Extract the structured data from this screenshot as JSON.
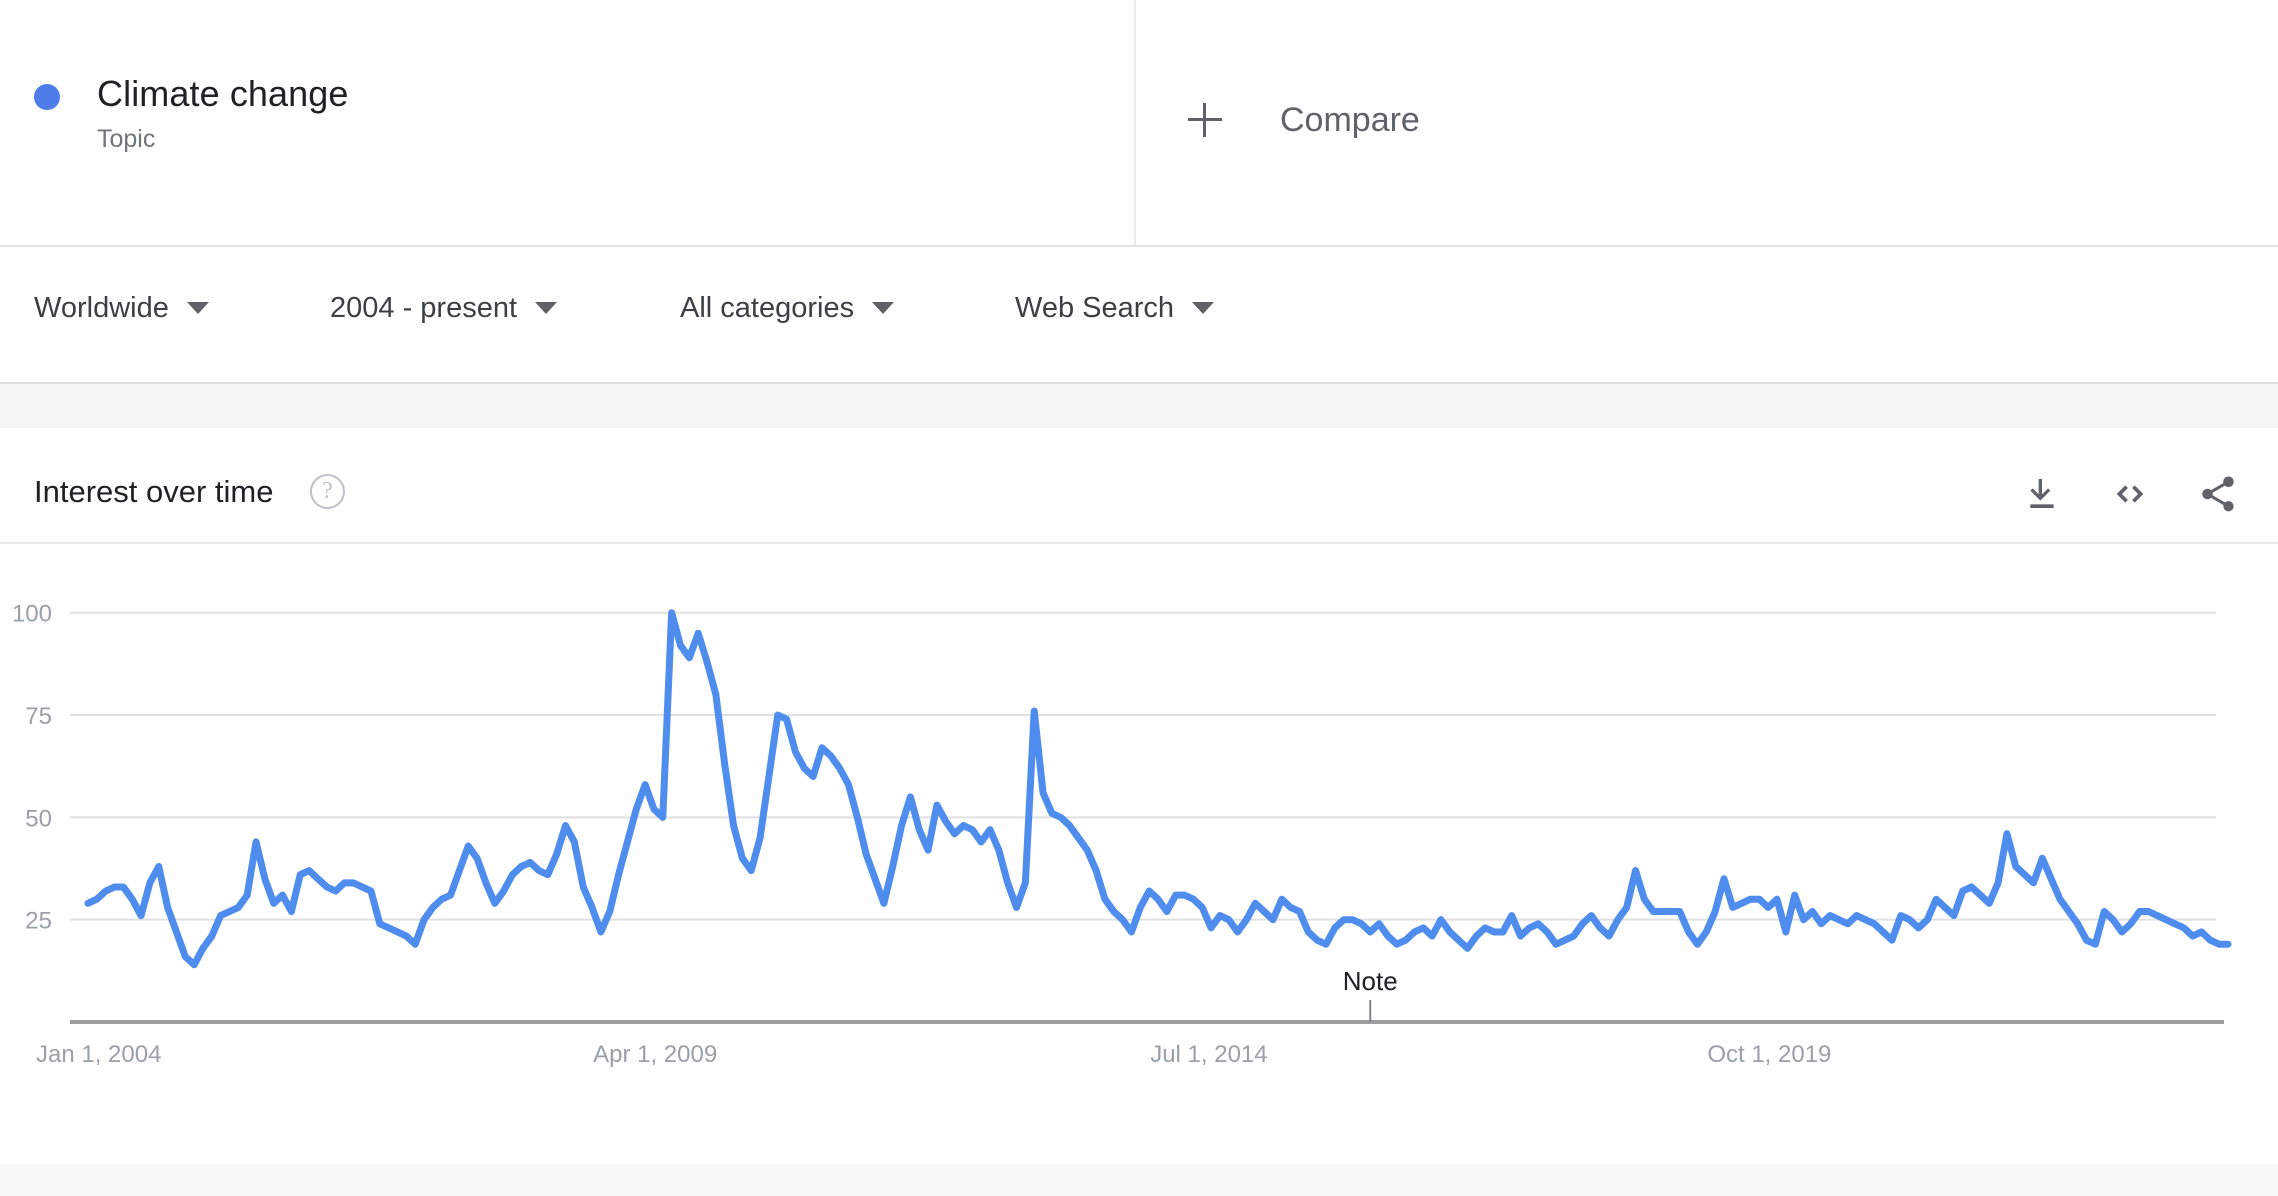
{
  "terms": {
    "items": [
      {
        "name": "Climate change",
        "type": "Topic",
        "color": "#4e7ce8"
      }
    ],
    "compare_label": "Compare"
  },
  "filters": [
    {
      "id": "location",
      "label": "Worldwide"
    },
    {
      "id": "time",
      "label": "2004 - present"
    },
    {
      "id": "category",
      "label": "All categories"
    },
    {
      "id": "search_type",
      "label": "Web Search"
    }
  ],
  "card": {
    "title": "Interest over time",
    "help_glyph": "?",
    "actions": [
      {
        "name": "download-icon",
        "label": "Download"
      },
      {
        "name": "embed-icon",
        "label": "Embed"
      },
      {
        "name": "share-icon",
        "label": "Share"
      }
    ]
  },
  "chart_data": {
    "type": "line",
    "title": "Interest over time",
    "xlabel": "",
    "ylabel": "",
    "ylim": [
      0,
      108
    ],
    "grid": true,
    "legend": "none",
    "y_ticks": [
      100,
      75,
      50,
      25
    ],
    "x_ticks": [
      {
        "label": "Jan 1, 2004",
        "index": 0
      },
      {
        "label": "Apr 1, 2009",
        "index": 63
      },
      {
        "label": "Jul 1, 2014",
        "index": 126
      },
      {
        "label": "Oct 1, 2019",
        "index": 189
      }
    ],
    "annotations": [
      {
        "label": "Note",
        "index": 145
      }
    ],
    "series": [
      {
        "name": "Climate change",
        "color": "#4e8cee",
        "values": [
          29,
          30,
          32,
          33,
          33,
          30,
          26,
          34,
          38,
          28,
          22,
          16,
          14,
          18,
          21,
          26,
          27,
          28,
          31,
          44,
          35,
          29,
          31,
          27,
          36,
          37,
          35,
          33,
          32,
          34,
          34,
          33,
          32,
          24,
          23,
          22,
          21,
          19,
          25,
          28,
          30,
          31,
          37,
          43,
          40,
          34,
          29,
          32,
          36,
          38,
          39,
          37,
          36,
          41,
          48,
          44,
          33,
          28,
          22,
          27,
          36,
          44,
          52,
          58,
          52,
          50,
          100,
          92,
          89,
          95,
          88,
          80,
          63,
          48,
          40,
          37,
          45,
          60,
          75,
          74,
          66,
          62,
          60,
          67,
          65,
          62,
          58,
          50,
          41,
          35,
          29,
          38,
          48,
          55,
          47,
          42,
          53,
          49,
          46,
          48,
          47,
          44,
          47,
          42,
          34,
          28,
          34,
          76,
          56,
          51,
          50,
          48,
          45,
          42,
          37,
          30,
          27,
          25,
          22,
          28,
          32,
          30,
          27,
          31,
          31,
          30,
          28,
          23,
          26,
          25,
          22,
          25,
          29,
          27,
          25,
          30,
          28,
          27,
          22,
          20,
          19,
          23,
          25,
          25,
          24,
          22,
          24,
          21,
          19,
          20,
          22,
          23,
          21,
          25,
          22,
          20,
          18,
          21,
          23,
          22,
          22,
          26,
          21,
          23,
          24,
          22,
          19,
          20,
          21,
          24,
          26,
          23,
          21,
          25,
          28,
          37,
          30,
          27,
          27,
          27,
          27,
          22,
          19,
          22,
          27,
          35,
          28,
          29,
          30,
          30,
          28,
          30,
          22,
          31,
          25,
          27,
          24,
          26,
          25,
          24,
          26,
          25,
          24,
          22,
          20,
          26,
          25,
          23,
          25,
          30,
          28,
          26,
          32,
          33,
          31,
          29,
          34,
          46,
          38,
          36,
          34,
          40,
          35,
          30,
          27,
          24,
          20,
          19,
          27,
          25,
          22,
          24,
          27,
          27,
          26,
          25,
          24,
          23,
          21,
          22,
          20,
          19,
          19
        ]
      }
    ]
  }
}
